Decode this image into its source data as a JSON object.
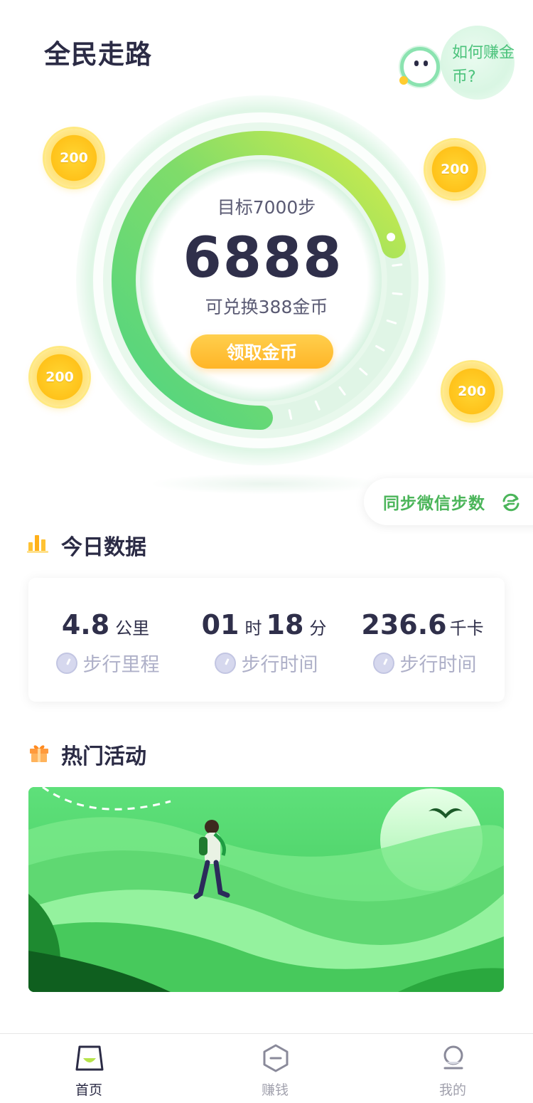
{
  "header": {
    "title": "全民走路",
    "help_text": "如何赚金币?"
  },
  "coins": [
    {
      "amount": "200"
    },
    {
      "amount": "200"
    },
    {
      "amount": "200"
    },
    {
      "amount": "200"
    }
  ],
  "progress": {
    "goal_label": "目标7000步",
    "steps": "6888",
    "steps_value": 6888,
    "goal_value": 7000,
    "exchange_label": "可兑换388金币",
    "claim_button": "领取金币",
    "ring_fill_fraction": 0.71
  },
  "sync": {
    "label": "同步微信步数"
  },
  "today": {
    "title": "今日数据",
    "stats": [
      {
        "value": "4.8",
        "unit": "公里",
        "label": "步行里程"
      },
      {
        "value": "01",
        "unit": "时",
        "value2": "18",
        "unit2": "分",
        "label": "步行时间"
      },
      {
        "value": "236.6",
        "unit": "千卡",
        "label": "步行时间"
      }
    ]
  },
  "activities": {
    "title": "热门活动"
  },
  "tabs": [
    {
      "label": "首页",
      "active": true
    },
    {
      "label": "赚钱",
      "active": false
    },
    {
      "label": "我的",
      "active": false
    }
  ],
  "colors": {
    "accent_green": "#4bb55a",
    "gold": "#ffbe2e",
    "text_dark": "#2b2b45",
    "muted": "#aeb0c8"
  }
}
